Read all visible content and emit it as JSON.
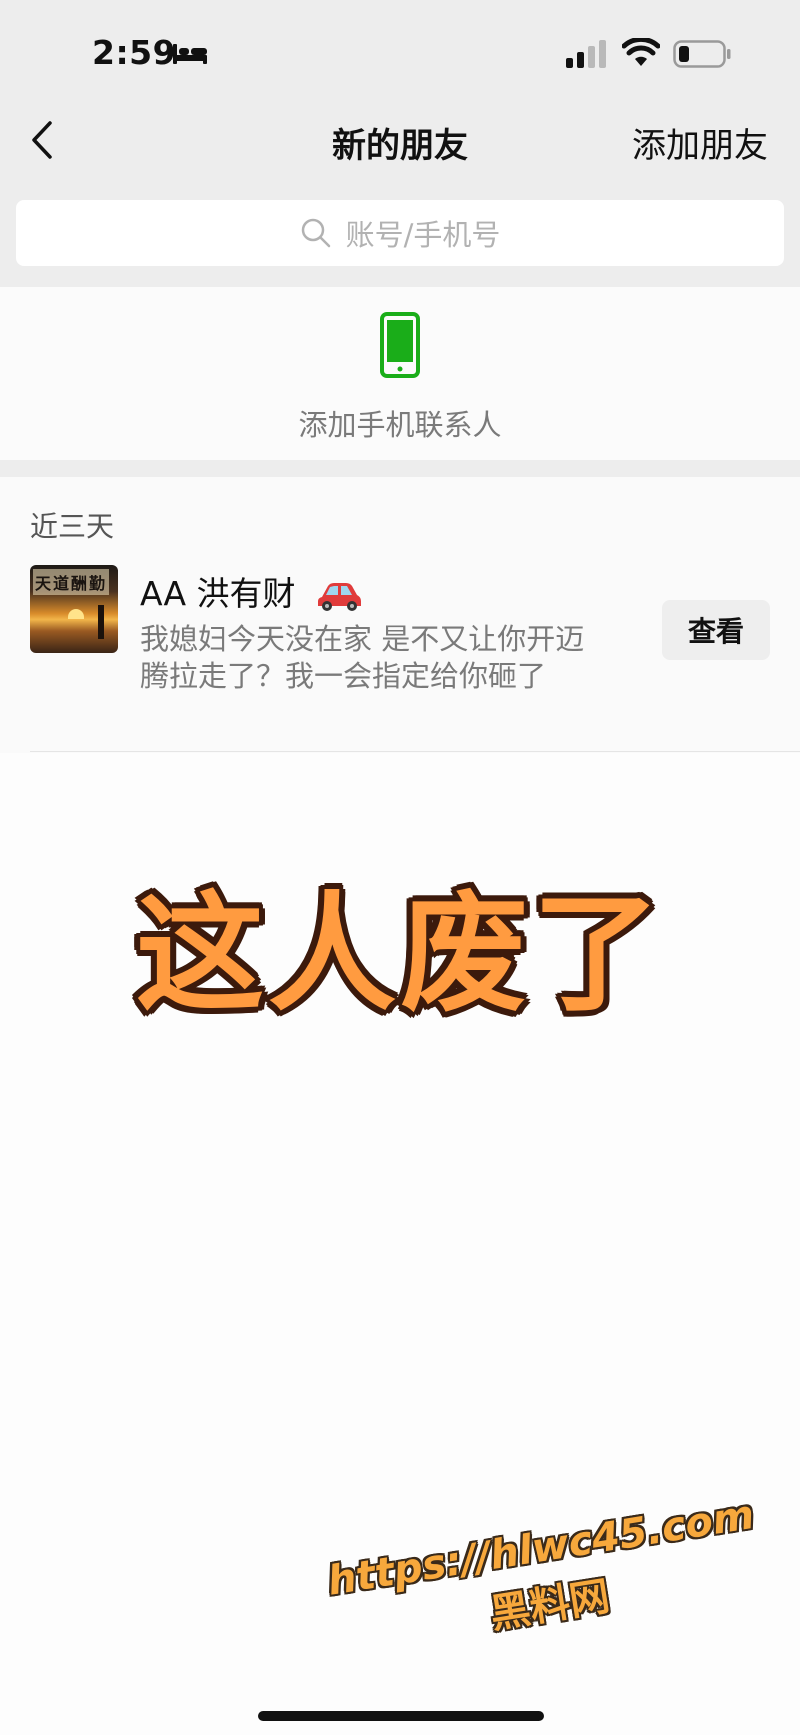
{
  "status_bar": {
    "time": "2:59",
    "icons": [
      "bed-icon",
      "signal-icon",
      "wifi-icon",
      "battery-icon"
    ]
  },
  "nav": {
    "back_icon": "chevron-left-icon",
    "title": "新的朋友",
    "add_friend_label": "添加朋友"
  },
  "search": {
    "icon": "search-icon",
    "placeholder": "账号/手机号"
  },
  "phone_contacts": {
    "icon": "phone-icon",
    "icon_color": "#1aad19",
    "label": "添加手机联系人"
  },
  "recent": {
    "header": "近三天",
    "items": [
      {
        "avatar_text": "天道酬勤",
        "name": "AA 洪有财",
        "name_icon": "red-car-icon",
        "message": "我媳妇今天没在家 是不又让你开迈腾拉走了？我一会指定给你砸了",
        "button_label": "查看"
      }
    ]
  },
  "overlay": {
    "text": "这人废了",
    "fill_color": "#ff9b40",
    "outline_color": "#3c1a0c"
  },
  "watermark": {
    "url": "https://hlwc45.com",
    "label": "黑料网"
  }
}
